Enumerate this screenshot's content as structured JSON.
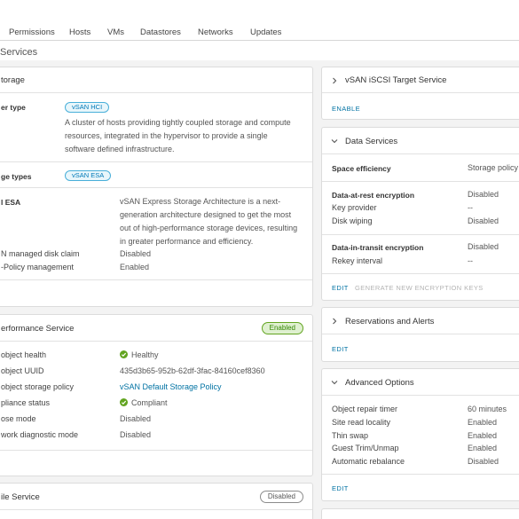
{
  "tabs": [
    "Permissions",
    "Hosts",
    "VMs",
    "Datastores",
    "Networks",
    "Updates"
  ],
  "page_title": "Services",
  "storage": {
    "title": "torage",
    "cluster_type_label": "er type",
    "cluster_type_pill": "vSAN HCI",
    "cluster_desc": "A cluster of hosts providing tightly coupled storage and compute resources, integrated in the hypervisor to provide a single software defined infrastructure.",
    "storage_types_label": "ge types",
    "storage_types_pill": "vSAN ESA",
    "esa_label": "l ESA",
    "esa_desc": "vSAN Express Storage Architecture is a next-generation architecture designed to get the most out of high-performance storage devices, resulting in greater performance and efficiency.",
    "disk_claim_label": "N managed disk claim",
    "disk_claim_value": "Disabled",
    "policy_mgmt_label": "-Policy management",
    "policy_mgmt_value": "Enabled"
  },
  "performance": {
    "title": "erformance Service",
    "status": "Enabled",
    "rows": [
      {
        "label": "object health",
        "value": "Healthy"
      },
      {
        "label": "object UUID",
        "value": "435d3b65-952b-62df-3fac-84160cef8360"
      },
      {
        "label": "object storage policy",
        "value": "vSAN Default Storage Policy"
      },
      {
        "label": "pliance status",
        "value": "Compliant"
      },
      {
        "label": "ose mode",
        "value": "Disabled"
      },
      {
        "label": "work diagnostic mode",
        "value": "Disabled"
      }
    ]
  },
  "file_service": {
    "title": "ile Service",
    "status": "Disabled"
  },
  "iscsi": {
    "title": "vSAN iSCSI Target Service",
    "action": "ENABLE"
  },
  "data_services": {
    "title": "Data Services",
    "space_label": "Space efficiency",
    "space_value": "Storage policy",
    "rest_label": "Data-at-rest encryption",
    "rest_value": "Disabled",
    "key_label": "Key provider",
    "key_value": "--",
    "wipe_label": "Disk wiping",
    "wipe_value": "Disabled",
    "transit_label": "Data-in-transit encryption",
    "transit_value": "Disabled",
    "rekey_label": "Rekey interval",
    "rekey_value": "--",
    "edit": "EDIT",
    "gen_keys": "GENERATE NEW ENCRYPTION KEYS"
  },
  "reservations": {
    "title": "Reservations and Alerts",
    "edit": "EDIT"
  },
  "advanced": {
    "title": "Advanced Options",
    "rows": [
      {
        "label": "Object repair timer",
        "value": "60 minutes"
      },
      {
        "label": "Site read locality",
        "value": "Enabled"
      },
      {
        "label": "Thin swap",
        "value": "Enabled"
      },
      {
        "label": "Guest Trim/Unmap",
        "value": "Enabled"
      },
      {
        "label": "Automatic rebalance",
        "value": "Disabled"
      }
    ],
    "edit": "EDIT"
  }
}
